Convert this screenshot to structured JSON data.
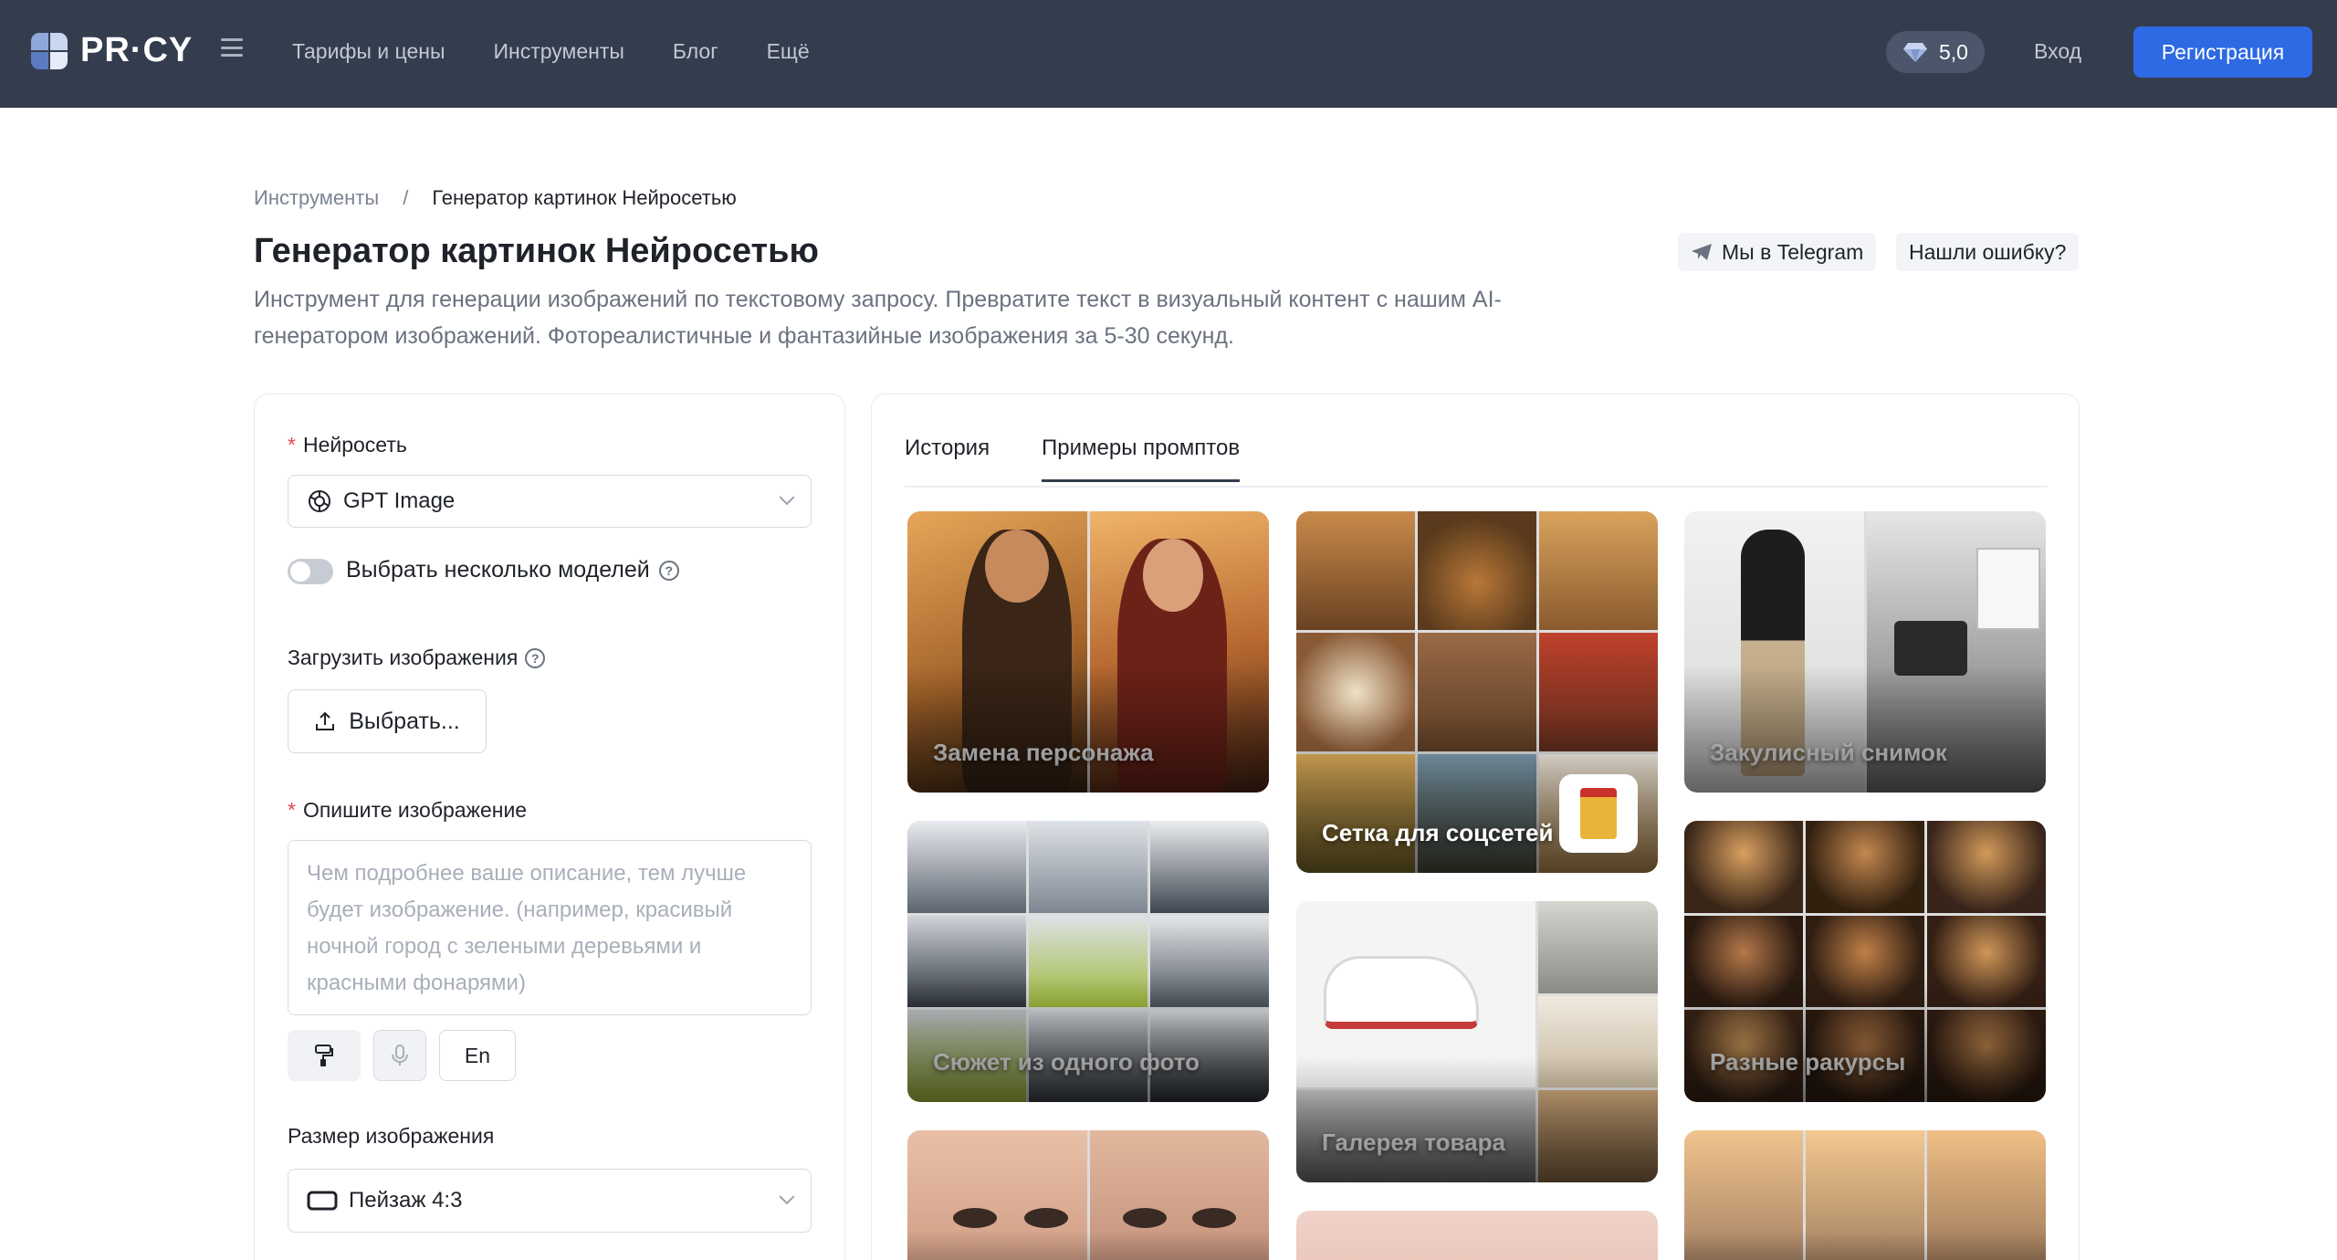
{
  "header": {
    "logo_text": "PR·CY",
    "nav": [
      "Тарифы и цены",
      "Инструменты",
      "Блог",
      "Ещё"
    ],
    "rating": "5,0",
    "login": "Вход",
    "register": "Регистрация"
  },
  "breadcrumb": {
    "root": "Инструменты",
    "separator": "/",
    "current": "Генератор картинок Нейросетью"
  },
  "page": {
    "title": "Генератор картинок Нейросетью",
    "description": "Инструмент для генерации изображений по текстовому запросу. Превратите текст в визуальный контент с нашим AI-генератором изображений. Фотореалистичные и фантазийные изображения за 5-30 секунд.",
    "telegram": "Мы в Telegram",
    "report_error": "Нашли ошибку?"
  },
  "form": {
    "model_label": "Нейросеть",
    "model_value": "GPT Image",
    "multi_label": "Выбрать несколько моделей",
    "upload_label": "Загрузить изображения",
    "upload_button": "Выбрать...",
    "prompt_label": "Опишите изображение",
    "prompt_placeholder": "Чем подробнее ваше описание, тем лучше будет изображение. (например, красивый ночной город с зелеными деревьями и красными фонарями)",
    "lang_button": "En",
    "size_label": "Размер изображения",
    "size_value": "Пейзаж 4:3"
  },
  "tabs": {
    "history": "История",
    "examples": "Примеры промптов"
  },
  "examples": [
    "Замена персонажа",
    "Сетка для соцсетей",
    "Закулисный снимок",
    "Сюжет из одного фото",
    "Галерея товара",
    "Разные ракурсы"
  ],
  "colors": {
    "header_bg": "#343d4e",
    "accent": "#2d6ae3",
    "required": "#e5484d"
  }
}
